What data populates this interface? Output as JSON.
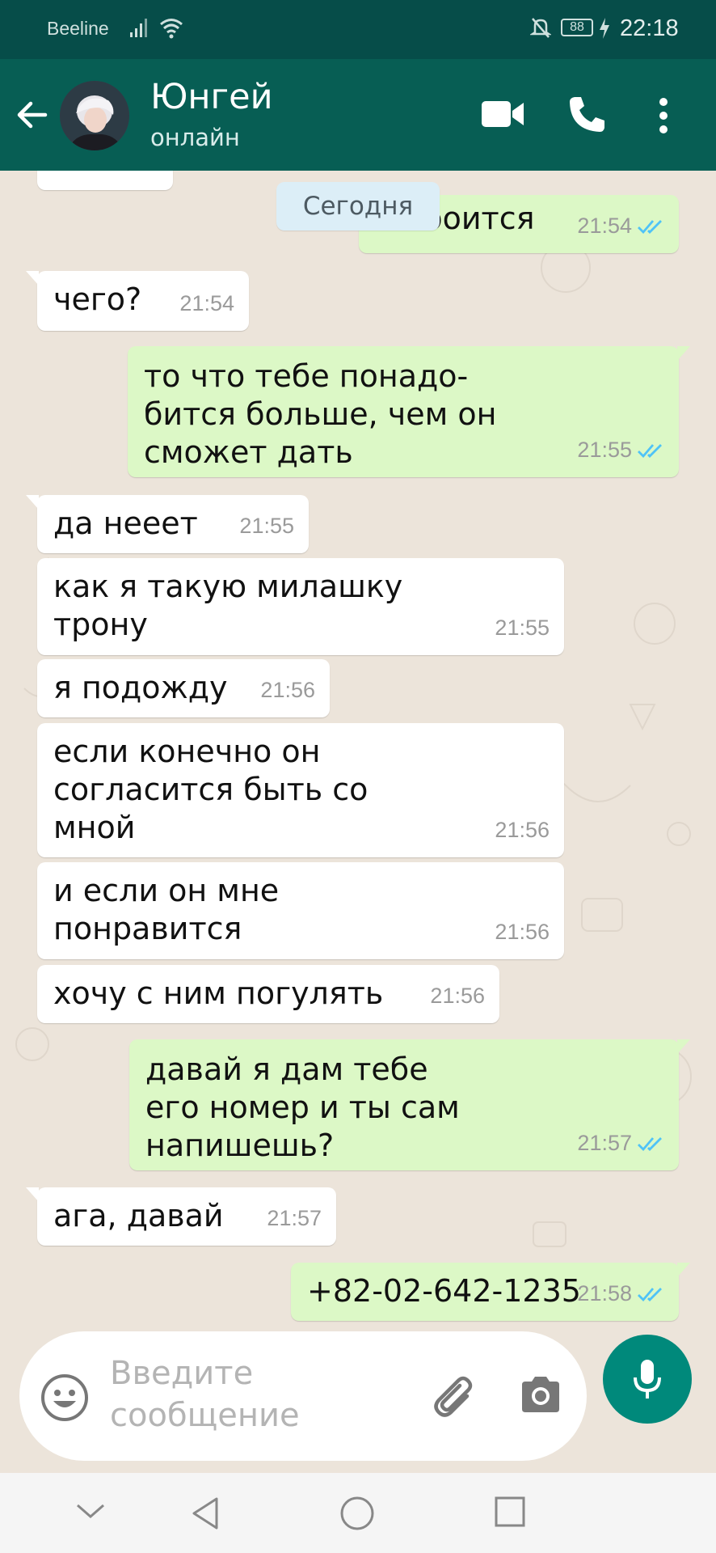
{
  "status_bar": {
    "carrier": "Beeline",
    "battery": "88",
    "time": "22:18"
  },
  "header": {
    "contact_name": "Юнгей",
    "contact_status": "онлайн"
  },
  "chat": {
    "date_label": "Сегодня",
    "messages": [
      {
        "dir": "out",
        "text": "он боится",
        "time": "21:54",
        "read": true
      },
      {
        "dir": "in",
        "text": "чего?",
        "time": "21:54"
      },
      {
        "dir": "out",
        "text": "то что тебе понадо-\nбится больше, чем он\nсможет дать",
        "time": "21:55",
        "read": true
      },
      {
        "dir": "in",
        "text": "да нееет",
        "time": "21:55"
      },
      {
        "dir": "in",
        "text": "как я такую милашку\nтрону",
        "time": "21:55"
      },
      {
        "dir": "in",
        "text": "я подожду",
        "time": "21:56"
      },
      {
        "dir": "in",
        "text": "если конечно он\nсогласится быть со\nмной",
        "time": "21:56"
      },
      {
        "dir": "in",
        "text": "и если он мне\nпонравится",
        "time": "21:56"
      },
      {
        "dir": "in",
        "text": "хочу с ним погулять",
        "time": "21:56"
      },
      {
        "dir": "out",
        "text": "давай я дам тебе\nего номер и ты сам\nнапишешь?",
        "time": "21:57",
        "read": true
      },
      {
        "dir": "in",
        "text": "ага, давай",
        "time": "21:57"
      },
      {
        "dir": "out",
        "text": "+82-02-642-1235",
        "time": "21:58",
        "read": true
      }
    ]
  },
  "composer": {
    "placeholder": "Введите сообщение"
  },
  "colors": {
    "header": "#075E54",
    "status_bar": "#064D49",
    "outgoing": "#DCF8C6",
    "incoming": "#FFFFFF",
    "read_ticks": "#4FC3F7",
    "mic": "#00897B"
  }
}
